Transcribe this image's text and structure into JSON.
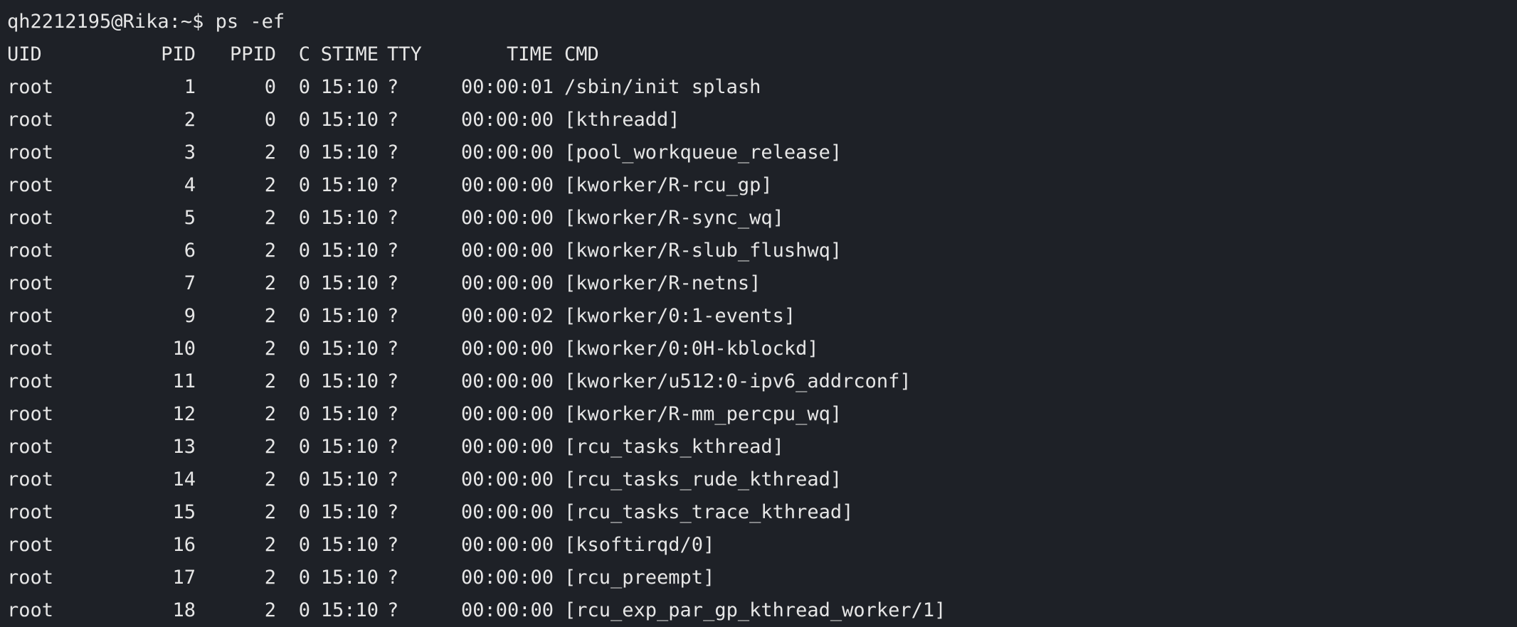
{
  "terminal": {
    "prompt": "qh2212195@Rika:~$ ps -ef",
    "headers": {
      "uid": "UID",
      "pid": "PID",
      "ppid": "PPID",
      "c": "C",
      "stime": "STIME",
      "tty": "TTY",
      "time": "TIME",
      "cmd": "CMD"
    },
    "rows": [
      {
        "uid": "root",
        "pid": "1",
        "ppid": "0",
        "c": "0",
        "stime": "15:10",
        "tty": "?",
        "time": "00:00:01",
        "cmd": "/sbin/init splash"
      },
      {
        "uid": "root",
        "pid": "2",
        "ppid": "0",
        "c": "0",
        "stime": "15:10",
        "tty": "?",
        "time": "00:00:00",
        "cmd": "[kthreadd]"
      },
      {
        "uid": "root",
        "pid": "3",
        "ppid": "2",
        "c": "0",
        "stime": "15:10",
        "tty": "?",
        "time": "00:00:00",
        "cmd": "[pool_workqueue_release]"
      },
      {
        "uid": "root",
        "pid": "4",
        "ppid": "2",
        "c": "0",
        "stime": "15:10",
        "tty": "?",
        "time": "00:00:00",
        "cmd": "[kworker/R-rcu_gp]"
      },
      {
        "uid": "root",
        "pid": "5",
        "ppid": "2",
        "c": "0",
        "stime": "15:10",
        "tty": "?",
        "time": "00:00:00",
        "cmd": "[kworker/R-sync_wq]"
      },
      {
        "uid": "root",
        "pid": "6",
        "ppid": "2",
        "c": "0",
        "stime": "15:10",
        "tty": "?",
        "time": "00:00:00",
        "cmd": "[kworker/R-slub_flushwq]"
      },
      {
        "uid": "root",
        "pid": "7",
        "ppid": "2",
        "c": "0",
        "stime": "15:10",
        "tty": "?",
        "time": "00:00:00",
        "cmd": "[kworker/R-netns]"
      },
      {
        "uid": "root",
        "pid": "9",
        "ppid": "2",
        "c": "0",
        "stime": "15:10",
        "tty": "?",
        "time": "00:00:02",
        "cmd": "[kworker/0:1-events]"
      },
      {
        "uid": "root",
        "pid": "10",
        "ppid": "2",
        "c": "0",
        "stime": "15:10",
        "tty": "?",
        "time": "00:00:00",
        "cmd": "[kworker/0:0H-kblockd]"
      },
      {
        "uid": "root",
        "pid": "11",
        "ppid": "2",
        "c": "0",
        "stime": "15:10",
        "tty": "?",
        "time": "00:00:00",
        "cmd": "[kworker/u512:0-ipv6_addrconf]"
      },
      {
        "uid": "root",
        "pid": "12",
        "ppid": "2",
        "c": "0",
        "stime": "15:10",
        "tty": "?",
        "time": "00:00:00",
        "cmd": "[kworker/R-mm_percpu_wq]"
      },
      {
        "uid": "root",
        "pid": "13",
        "ppid": "2",
        "c": "0",
        "stime": "15:10",
        "tty": "?",
        "time": "00:00:00",
        "cmd": "[rcu_tasks_kthread]"
      },
      {
        "uid": "root",
        "pid": "14",
        "ppid": "2",
        "c": "0",
        "stime": "15:10",
        "tty": "?",
        "time": "00:00:00",
        "cmd": "[rcu_tasks_rude_kthread]"
      },
      {
        "uid": "root",
        "pid": "15",
        "ppid": "2",
        "c": "0",
        "stime": "15:10",
        "tty": "?",
        "time": "00:00:00",
        "cmd": "[rcu_tasks_trace_kthread]"
      },
      {
        "uid": "root",
        "pid": "16",
        "ppid": "2",
        "c": "0",
        "stime": "15:10",
        "tty": "?",
        "time": "00:00:00",
        "cmd": "[ksoftirqd/0]"
      },
      {
        "uid": "root",
        "pid": "17",
        "ppid": "2",
        "c": "0",
        "stime": "15:10",
        "tty": "?",
        "time": "00:00:00",
        "cmd": "[rcu_preempt]"
      },
      {
        "uid": "root",
        "pid": "18",
        "ppid": "2",
        "c": "0",
        "stime": "15:10",
        "tty": "?",
        "time": "00:00:00",
        "cmd": "[rcu_exp_par_gp_kthread_worker/1]"
      }
    ]
  },
  "colors": {
    "background": "#1e2127",
    "text": "#e6e6e6"
  }
}
